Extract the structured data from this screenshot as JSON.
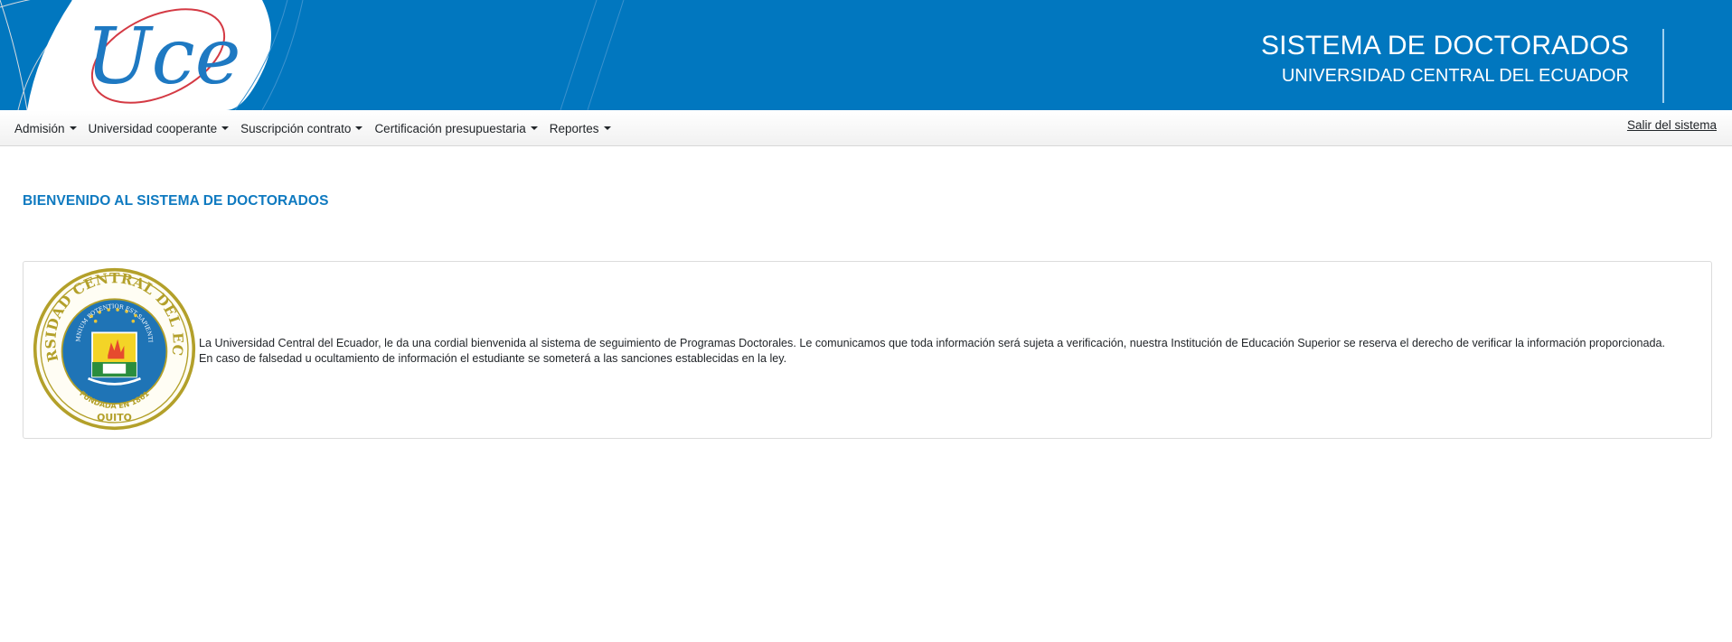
{
  "header": {
    "logo_text": "Uce",
    "title": "SISTEMA DE DOCTORADOS",
    "subtitle": "UNIVERSIDAD CENTRAL DEL ECUADOR"
  },
  "nav": {
    "items": [
      {
        "label": "Admisión"
      },
      {
        "label": "Universidad cooperante"
      },
      {
        "label": "Suscripción contrato"
      },
      {
        "label": "Certificación presupuestaria"
      },
      {
        "label": "Reportes"
      }
    ],
    "logout_label": "Salir del sistema"
  },
  "main": {
    "welcome_title": "BIENVENIDO AL SISTEMA DE DOCTORADOS",
    "seal": {
      "ring_text": "UNIVERSIDAD CENTRAL DEL ECUADOR",
      "founded_text": "FUNDADA EN 1861",
      "city_text": "QUITO",
      "motto_text": "OMNIUM POTENTIOR EST SAPIENTIA"
    },
    "message_line1": "La Universidad Central del Ecuador, le da una cordial bienvenida al sistema de seguimiento de Programas Doctorales. Le comunicamos que toda información será sujeta a verificación, nuestra Institución de Educación Superior se reserva el derecho de verificar la información proporcionada.",
    "message_line2": "En caso de falsedad u ocultamiento de información el estudiante se someterá a las sanciones establecidas en la ley."
  },
  "colors": {
    "header_blue": "#0177bf",
    "accent_blue": "#0f7ac0",
    "seal_gold": "#b3a02a",
    "seal_blue": "#1f74b6"
  },
  "icons": {
    "nav_caret": "caret-down-icon",
    "logo": "uce-logo-icon",
    "seal": "university-seal-icon"
  }
}
